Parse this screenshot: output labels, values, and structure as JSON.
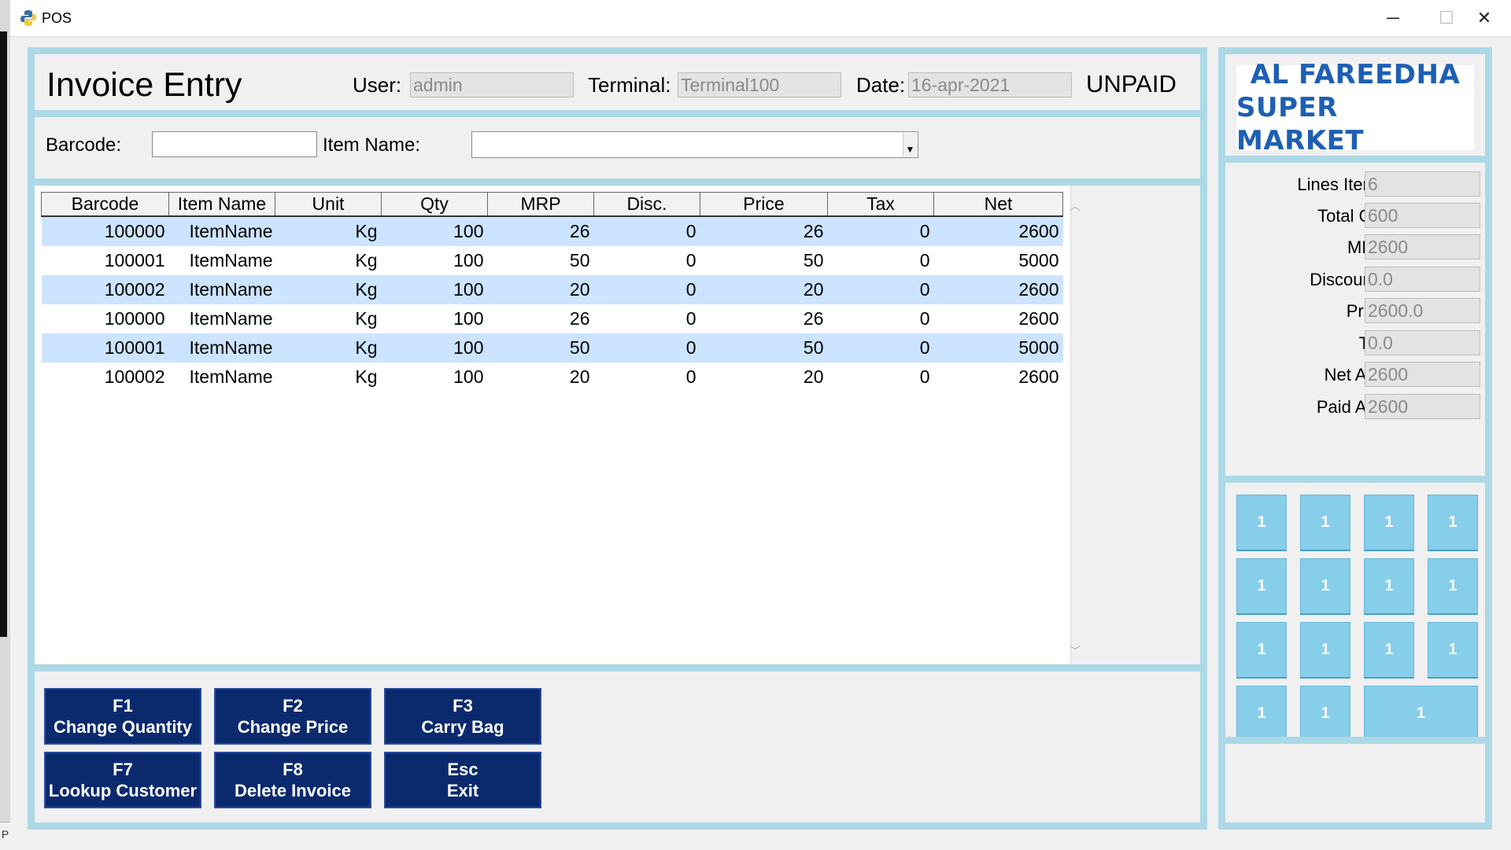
{
  "window": {
    "title": "POS",
    "minimize": "─",
    "maximize": "☐",
    "close": "✕"
  },
  "desktop": {
    "corner_text": "P"
  },
  "header": {
    "title": "Invoice Entry",
    "user_label": "User:",
    "user_value": "admin",
    "terminal_label": "Terminal:",
    "terminal_value": "Terminal100",
    "date_label": "Date:",
    "date_value": "16-apr-2021",
    "status": "UNPAID"
  },
  "entry": {
    "barcode_label": "Barcode:",
    "barcode_value": "",
    "item_label": "Item Name:",
    "item_value": ""
  },
  "table": {
    "columns": [
      "Barcode",
      "Item Name",
      "Unit",
      "Qty",
      "MRP",
      "Disc.",
      "Price",
      "Tax",
      "Net"
    ],
    "rows": [
      [
        "100000",
        "ItemName",
        "Kg",
        "100",
        "26",
        "0",
        "26",
        "0",
        "2600"
      ],
      [
        "100001",
        "ItemName",
        "Kg",
        "100",
        "50",
        "0",
        "50",
        "0",
        "5000"
      ],
      [
        "100002",
        "ItemName",
        "Kg",
        "100",
        "20",
        "0",
        "20",
        "0",
        "2600"
      ],
      [
        "100000",
        "ItemName",
        "Kg",
        "100",
        "26",
        "0",
        "26",
        "0",
        "2600"
      ],
      [
        "100001",
        "ItemName",
        "Kg",
        "100",
        "50",
        "0",
        "50",
        "0",
        "5000"
      ],
      [
        "100002",
        "ItemName",
        "Kg",
        "100",
        "20",
        "0",
        "20",
        "0",
        "2600"
      ]
    ],
    "highlighted_rows": [
      0,
      2,
      4
    ]
  },
  "function_buttons": [
    {
      "key": "F1",
      "label": "Change Quantity"
    },
    {
      "key": "F2",
      "label": "Change Price"
    },
    {
      "key": "F3",
      "label": "Carry Bag"
    },
    {
      "key": "F7",
      "label": "Lookup Customer"
    },
    {
      "key": "F8",
      "label": "Delete Invoice"
    },
    {
      "key": "Esc",
      "label": "Exit"
    }
  ],
  "store": {
    "name_line1": "AL FAREEDHA",
    "name_line2": "SUPER MARKET"
  },
  "summary": {
    "lines_items_label": "Lines Items:",
    "lines_items": "6",
    "total_qty_label": "Total Qty:",
    "total_qty": "600",
    "mrp_label": "MRP:",
    "mrp": "2600",
    "discounts_label": "Discounts:",
    "discounts": "0.0",
    "price_label": "Price:",
    "price": "2600.0",
    "tax_label": "Tax:",
    "tax": "0.0",
    "net_amt_label": "Net Amt:",
    "net_amt": "2600",
    "paid_amt_label": "Paid Amt:",
    "paid_amt": "2600"
  },
  "keypad": {
    "keys": [
      "1",
      "1",
      "1",
      "1",
      "1",
      "1",
      "1",
      "1",
      "1",
      "1",
      "1",
      "1",
      "1",
      "1",
      "1"
    ]
  },
  "colors": {
    "panel_border": "#add8e6",
    "button_navy": "#0b2a6e",
    "keypad_blue": "#87ceeb",
    "row_highlight": "#cce4ff",
    "logo_blue": "#1e5fb3"
  }
}
